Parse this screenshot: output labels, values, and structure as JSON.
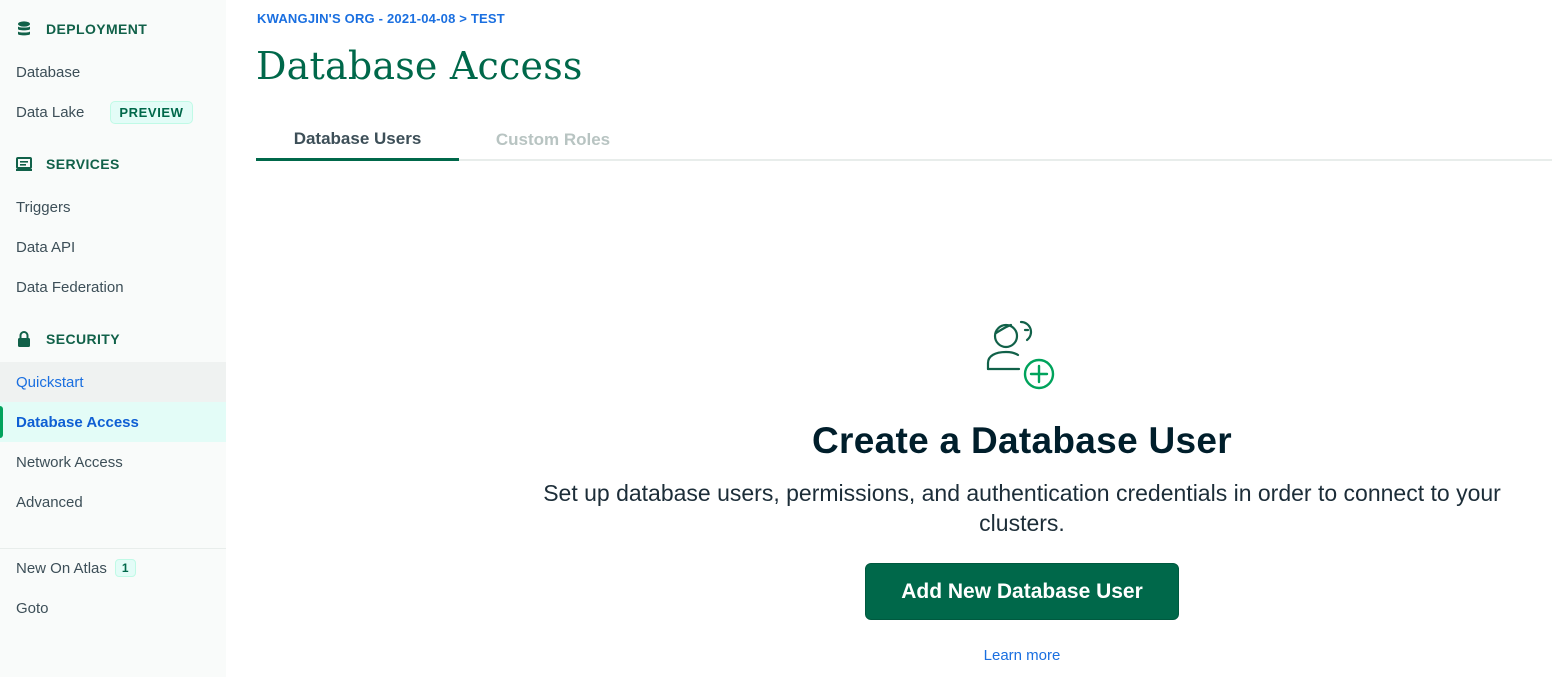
{
  "sidebar": {
    "deployment": {
      "header": "DEPLOYMENT",
      "icon": "database-icon",
      "items": [
        {
          "label": "Database"
        },
        {
          "label": "Data Lake",
          "badge": "PREVIEW"
        }
      ]
    },
    "services": {
      "header": "SERVICES",
      "icon": "services-icon",
      "items": [
        {
          "label": "Triggers"
        },
        {
          "label": "Data API"
        },
        {
          "label": "Data Federation"
        }
      ]
    },
    "security": {
      "header": "SECURITY",
      "icon": "lock-icon",
      "items": [
        {
          "label": "Quickstart"
        },
        {
          "label": "Database Access",
          "active": true
        },
        {
          "label": "Network Access"
        },
        {
          "label": "Advanced"
        }
      ]
    },
    "footer": {
      "items": [
        {
          "label": "New On Atlas",
          "count": "1"
        },
        {
          "label": "Goto"
        }
      ]
    }
  },
  "breadcrumb": "KWANGJIN'S ORG - 2021-04-08 > TEST",
  "page_title": "Database Access",
  "tabs": [
    {
      "label": "Database Users",
      "active": true
    },
    {
      "label": "Custom Roles",
      "active": false
    }
  ],
  "empty_state": {
    "icon": "add-user-icon",
    "title": "Create a Database User",
    "description": "Set up database users, permissions, and authentication credentials in order to connect to your clusters.",
    "button_label": "Add New Database User",
    "learn_more": "Learn more"
  },
  "colors": {
    "brand_green": "#00684a",
    "accent_green": "#00a35c",
    "link_blue": "#1a6fe0",
    "icon_plus_green": "#00ed64"
  }
}
